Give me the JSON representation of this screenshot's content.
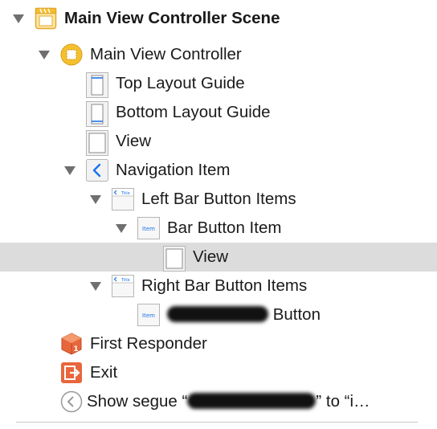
{
  "outline": {
    "scene_title": "Main View Controller Scene",
    "view_controller": "Main View Controller",
    "top_layout_guide": "Top Layout Guide",
    "bottom_layout_guide": "Bottom Layout Guide",
    "view": "View",
    "navigation_item": "Navigation Item",
    "left_bar_button_items": "Left Bar Button Items",
    "bar_button_item": "Bar Button Item",
    "nested_view": "View",
    "right_bar_button_items": "Right Bar Button Items",
    "right_button_suffix": "Button",
    "first_responder": "First Responder",
    "exit": "Exit",
    "segue_prefix": "Show segue “",
    "segue_suffix": "” to “i…",
    "item_badge": "Item",
    "title_badge": "Title"
  },
  "colors": {
    "selection": "#dcdcdc",
    "accent_blue": "#1a73e8",
    "scene_yellow": "#f5c030",
    "responder_orange": "#e8663c"
  },
  "icons": {
    "scene": "storyboard-scene-icon",
    "view_controller": "view-controller-icon",
    "layout_guide": "layout-guide-icon",
    "view": "view-icon",
    "navigation_item": "navigation-item-icon",
    "bar_button_items": "bar-button-items-icon",
    "bar_button_item": "bar-button-item-icon",
    "first_responder": "first-responder-icon",
    "exit": "exit-icon",
    "segue": "segue-icon"
  }
}
